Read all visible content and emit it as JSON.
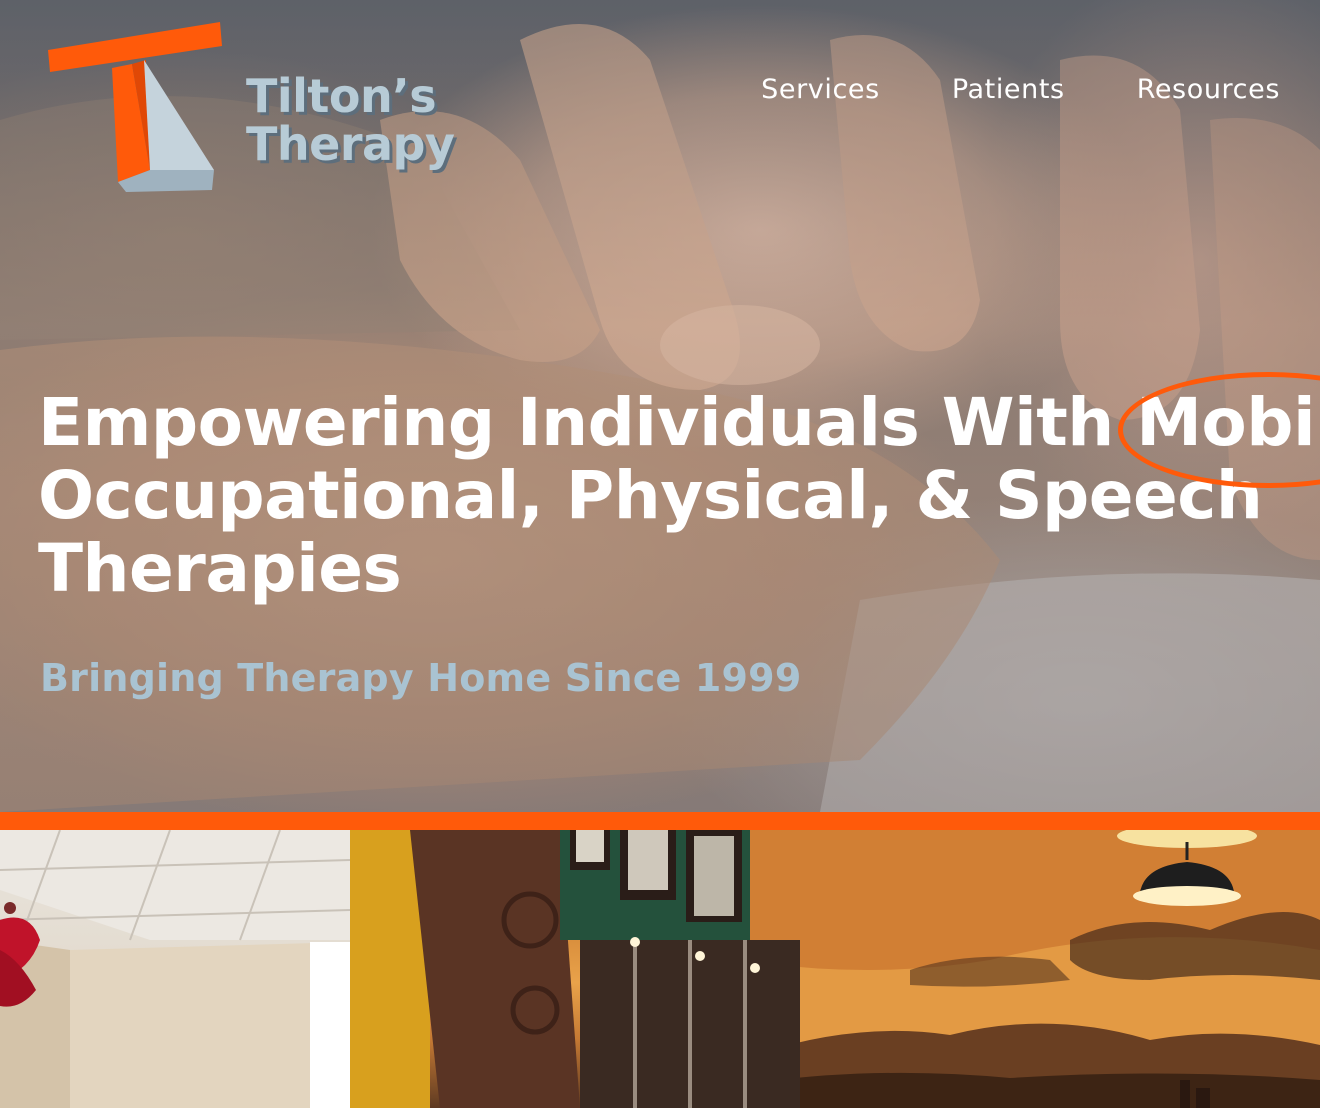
{
  "brand": {
    "name_line1": "Tilton’s",
    "name_line2": "Therapy",
    "colors": {
      "accent": "#ff5a0a",
      "logo_text": "#b7cbd6",
      "tagline": "#a9c3d2"
    }
  },
  "nav": {
    "items": [
      {
        "label": "Services"
      },
      {
        "label": "Patients"
      },
      {
        "label": "Resources"
      }
    ]
  },
  "hero": {
    "headline_line1": "Empowering Individuals With Mobi",
    "headline_line2": "Occupational, Physical, & Speech",
    "headline_line3": "Therapies",
    "tagline": "Bringing Therapy Home Since 1999"
  },
  "icons": {
    "logo": "letter-t-logo-icon"
  }
}
